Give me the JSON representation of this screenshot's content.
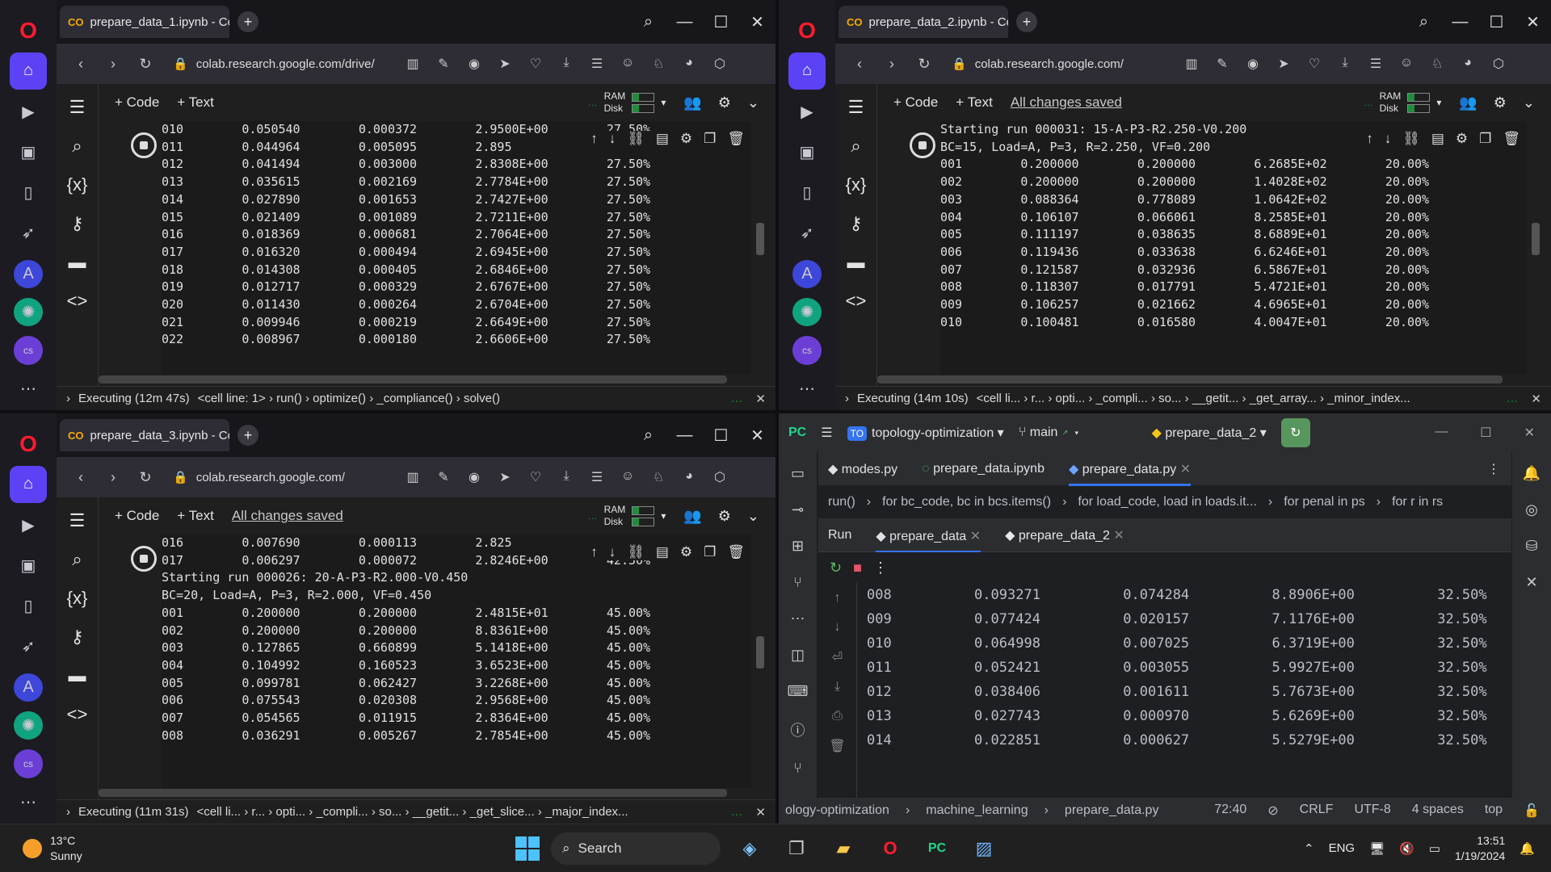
{
  "windows": [
    {
      "tab_title": "prepare_data_1.ipynb - Co",
      "url": "colab.research.google.com/drive/",
      "saved_text": "",
      "output_lines": [
        "010        0.050540        0.000372        2.9500E+00        27.50%",
        "011        0.044964        0.005095        2.895",
        "012        0.041494        0.003000        2.8308E+00        27.50%",
        "013        0.035615        0.002169        2.7784E+00        27.50%",
        "014        0.027890        0.001653        2.7427E+00        27.50%",
        "015        0.021409        0.001089        2.7211E+00        27.50%",
        "016        0.018369        0.000681        2.7064E+00        27.50%",
        "017        0.016320        0.000494        2.6945E+00        27.50%",
        "018        0.014308        0.000405        2.6846E+00        27.50%",
        "019        0.012717        0.000329        2.6767E+00        27.50%",
        "020        0.011430        0.000264        2.6704E+00        27.50%",
        "021        0.009946        0.000219        2.6649E+00        27.50%",
        "022        0.008967        0.000180        2.6606E+00        27.50%"
      ],
      "status": "Executing (12m 47s)",
      "trace": [
        "<cell line: 1>",
        "run()",
        "optimize()",
        "_compliance()",
        "solve()"
      ]
    },
    {
      "tab_title": "prepare_data_2.ipynb - Co",
      "url": "colab.research.google.com/",
      "saved_text": "All changes saved",
      "output_lines": [
        "Starting run 000031: 15-A-P3-R2.250-V0.200",
        "BC=15, Load=A, P=3, R=2.250, VF=0.200",
        "001        0.200000        0.200000        6.2685E+02        20.00%",
        "002        0.200000        0.200000        1.4028E+02        20.00%",
        "003        0.088364        0.778089        1.0642E+02        20.00%",
        "004        0.106107        0.066061        8.2585E+01        20.00%",
        "005        0.111197        0.038635        8.6889E+01        20.00%",
        "006        0.119436        0.033638        6.6246E+01        20.00%",
        "007        0.121587        0.032936        6.5867E+01        20.00%",
        "008        0.118307        0.017791        5.4721E+01        20.00%",
        "009        0.106257        0.021662        4.6965E+01        20.00%",
        "010        0.100481        0.016580        4.0047E+01        20.00%"
      ],
      "status": "Executing (14m 10s)",
      "trace": [
        "<cell li...",
        "r...",
        "opti...",
        "_compli...",
        "so...",
        "__getit...",
        "_get_array...",
        "_minor_index..."
      ]
    },
    {
      "tab_title": "prepare_data_3.ipynb - Co",
      "url": "colab.research.google.com/",
      "saved_text": "All changes saved",
      "output_lines": [
        "016        0.007690        0.000113        2.825",
        "017        0.006297        0.000072        2.8246E+00        42.50%",
        "Starting run 000026: 20-A-P3-R2.000-V0.450",
        "BC=20, Load=A, P=3, R=2.000, VF=0.450",
        "001        0.200000        0.200000        2.4815E+01        45.00%",
        "002        0.200000        0.200000        8.8361E+00        45.00%",
        "003        0.127865        0.660899        5.1418E+00        45.00%",
        "004        0.104992        0.160523        3.6523E+00        45.00%",
        "005        0.099781        0.062427        3.2268E+00        45.00%",
        "006        0.075543        0.020308        2.9568E+00        45.00%",
        "007        0.054565        0.011915        2.8364E+00        45.00%",
        "008        0.036291        0.005267        2.7854E+00        45.00%"
      ],
      "status": "Executing (11m 31s)",
      "trace": [
        "<cell li...",
        "r...",
        "opti...",
        "_compli...",
        "so...",
        "__getit...",
        "_get_slice...",
        "_major_index..."
      ]
    }
  ],
  "colab_toolbar": {
    "code": "+ Code",
    "text": "+ Text",
    "ram": "RAM",
    "disk": "Disk"
  },
  "pycharm": {
    "project_badge": "TO",
    "project": "topology-optimization",
    "branch": "main",
    "run_config": "prepare_data_2",
    "tabs": [
      "modes.py",
      "prepare_data.ipynb",
      "prepare_data.py"
    ],
    "crumbs": [
      "run()",
      "for bc_code, bc in bcs.items()",
      "for load_code, load in loads.it...",
      "for penal in ps",
      "for r in rs"
    ],
    "run_label": "Run",
    "run_tabs": [
      "prepare_data",
      "prepare_data_2"
    ],
    "output_lines": [
      "008          0.093271          0.074284          8.8906E+00          32.50%",
      "009          0.077424          0.020157          7.1176E+00          32.50%",
      "010          0.064998          0.007025          6.3719E+00          32.50%",
      "011          0.052421          0.003055          5.9927E+00          32.50%",
      "012          0.038406          0.001611          5.7673E+00          32.50%",
      "013          0.027743          0.000970          5.6269E+00          32.50%",
      "014          0.022851          0.000627          5.5279E+00          32.50%"
    ],
    "status_path": [
      "ology-optimization",
      "machine_learning",
      "prepare_data.py"
    ],
    "status_right": [
      "72:40",
      "CRLF",
      "UTF-8",
      "4 spaces",
      "top"
    ]
  },
  "taskbar": {
    "temp": "13°C",
    "weather": "Sunny",
    "search": "Search",
    "lang": "ENG",
    "time": "13:51",
    "date": "1/19/2024"
  }
}
